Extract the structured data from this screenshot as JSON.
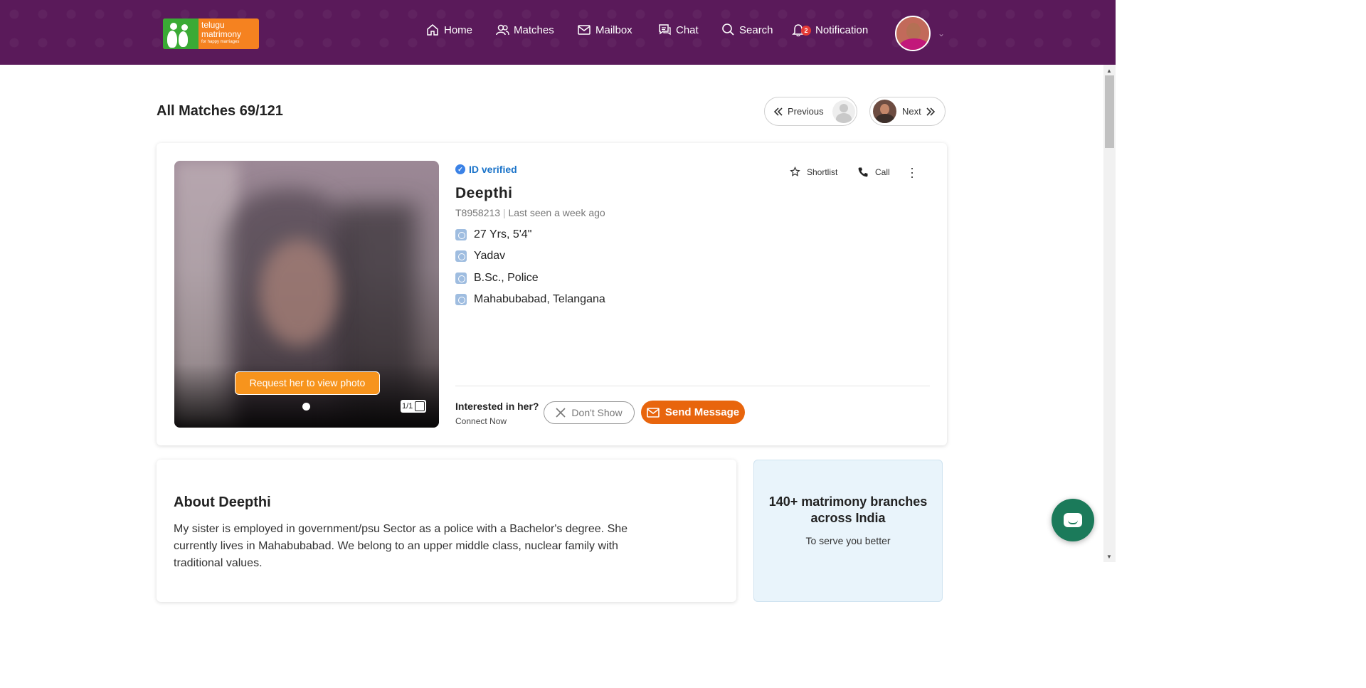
{
  "logo": {
    "line1": "telugu",
    "line2": "matrimony",
    "tagline": "for happy marriages"
  },
  "nav": {
    "home": "Home",
    "matches": "Matches",
    "mailbox": "Mailbox",
    "chat": "Chat",
    "search": "Search",
    "notification": "Notification",
    "notification_count": "2"
  },
  "page": {
    "title": "All Matches 69/121"
  },
  "pager": {
    "previous": "Previous",
    "next": "Next"
  },
  "profile": {
    "verified": "ID verified",
    "name": "Deepthi",
    "id": "T8958213",
    "last_seen": "Last seen a week ago",
    "attributes": [
      {
        "icon": "age-height-icon",
        "text": "27 Yrs, 5'4\""
      },
      {
        "icon": "caste-icon",
        "text": "Yadav"
      },
      {
        "icon": "education-icon",
        "text": "B.Sc., Police"
      },
      {
        "icon": "location-icon",
        "text": "Mahabubabad, Telangana"
      }
    ],
    "request_photo": "Request her to view photo",
    "photo_counter": "1/1",
    "shortlist": "Shortlist",
    "call": "Call",
    "interested": "Interested in her?",
    "connect_now": "Connect Now",
    "dont_show": "Don't Show",
    "send_message": "Send Message"
  },
  "about": {
    "title": "About Deepthi",
    "text": "My sister is employed in government/psu Sector as a police with a Bachelor's degree. She currently lives in Mahabubabad. We belong to an upper middle class, nuclear family with traditional values."
  },
  "branches": {
    "title": "140+ matrimony branches across India",
    "subtitle": "To serve you better"
  },
  "colors": {
    "header": "#5a1a5a",
    "accent": "#e8650d",
    "verified": "#1a73c9",
    "chat_fab": "#1b7a5a"
  }
}
